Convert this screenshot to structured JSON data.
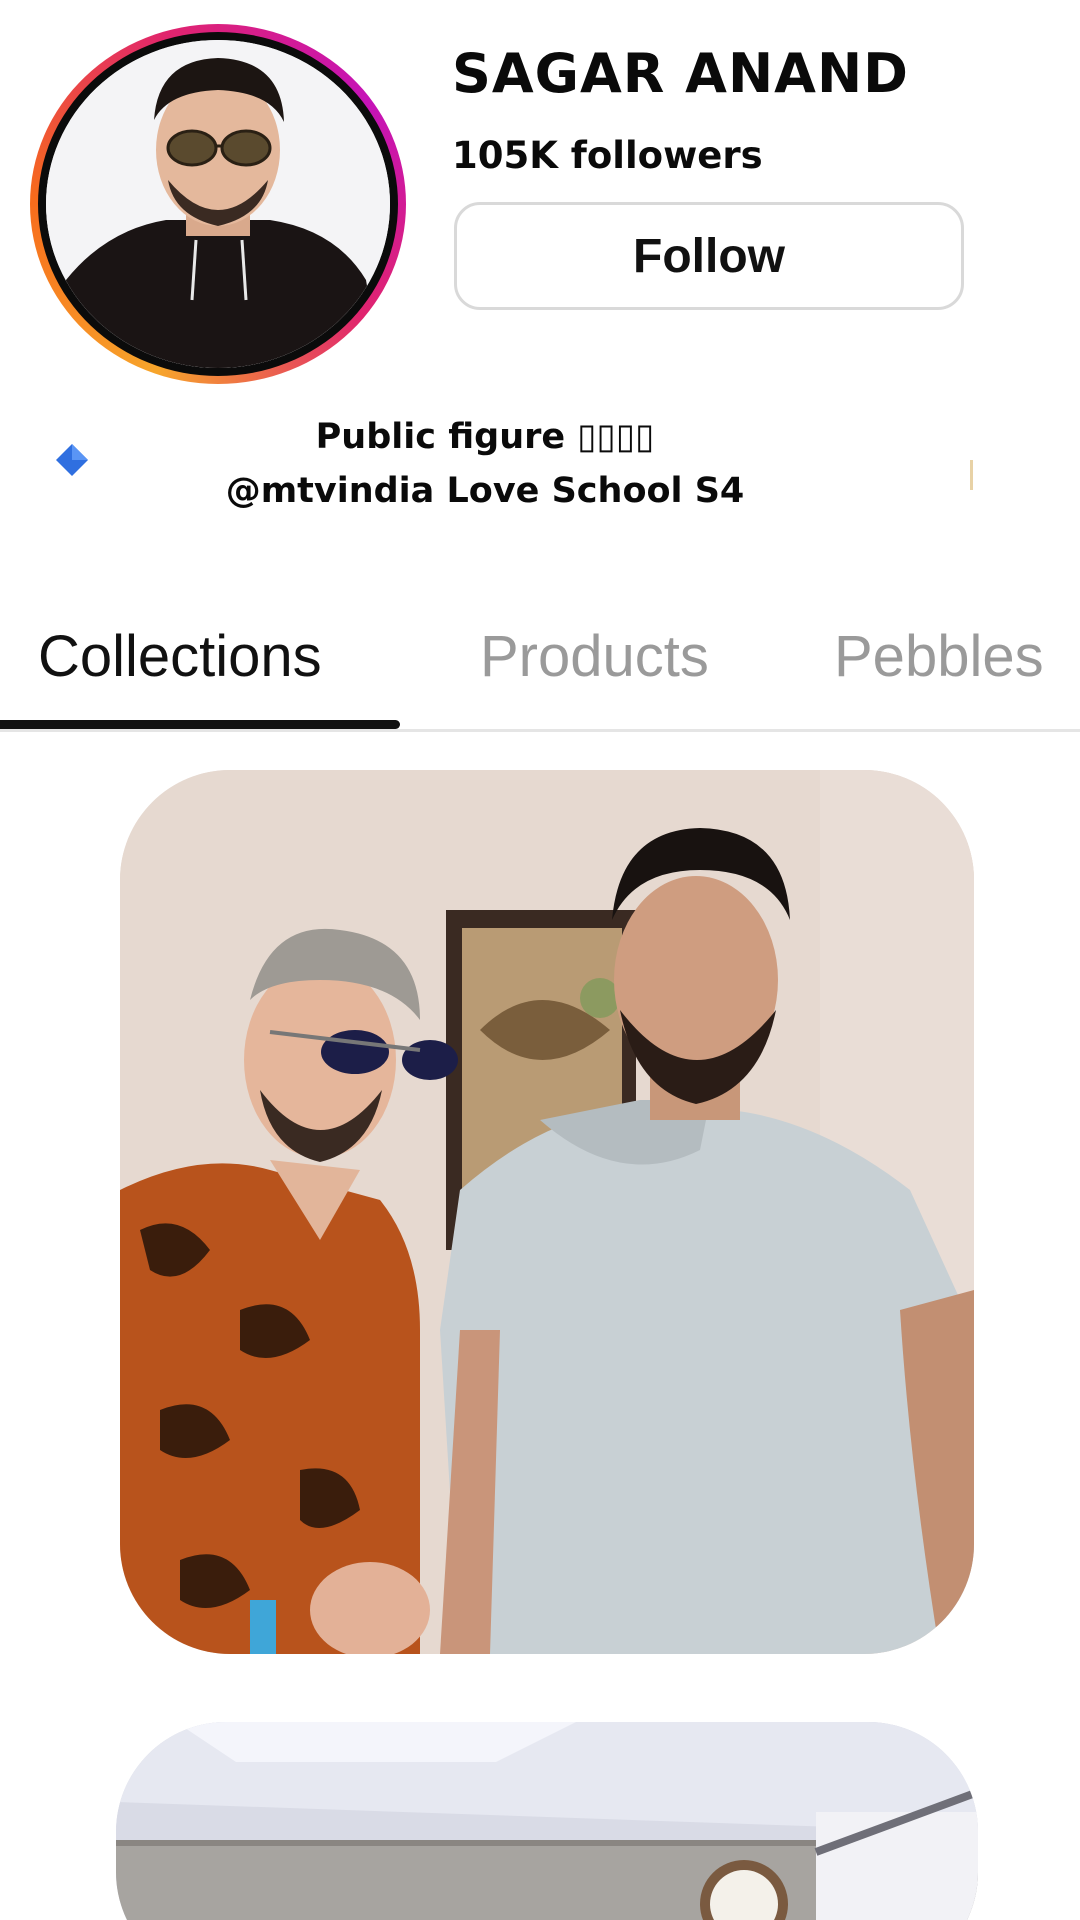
{
  "profile": {
    "name": "SAGAR ANAND",
    "followers": "105K followers",
    "follow_label": "Follow",
    "avatar_icon": "profile-photo"
  },
  "bio": {
    "line1": "Public figure ▯▯▯▯",
    "line2": "@mtvindia Love School S4",
    "badge_icon": "blue-diamond-icon",
    "badge_color": "#2f6fe0"
  },
  "tabs": [
    {
      "label": "Collections",
      "active": true
    },
    {
      "label": "Products",
      "active": false
    },
    {
      "label": "Pebbles",
      "active": false
    }
  ],
  "collections": [
    {
      "icon": "collection-photo"
    },
    {
      "icon": "collection-photo"
    }
  ],
  "colors": {
    "avatar_ring_start": "#f7a52b",
    "avatar_ring_end": "#c513b8",
    "active_tab": "#111111",
    "inactive_tab": "#9a9a9a"
  }
}
